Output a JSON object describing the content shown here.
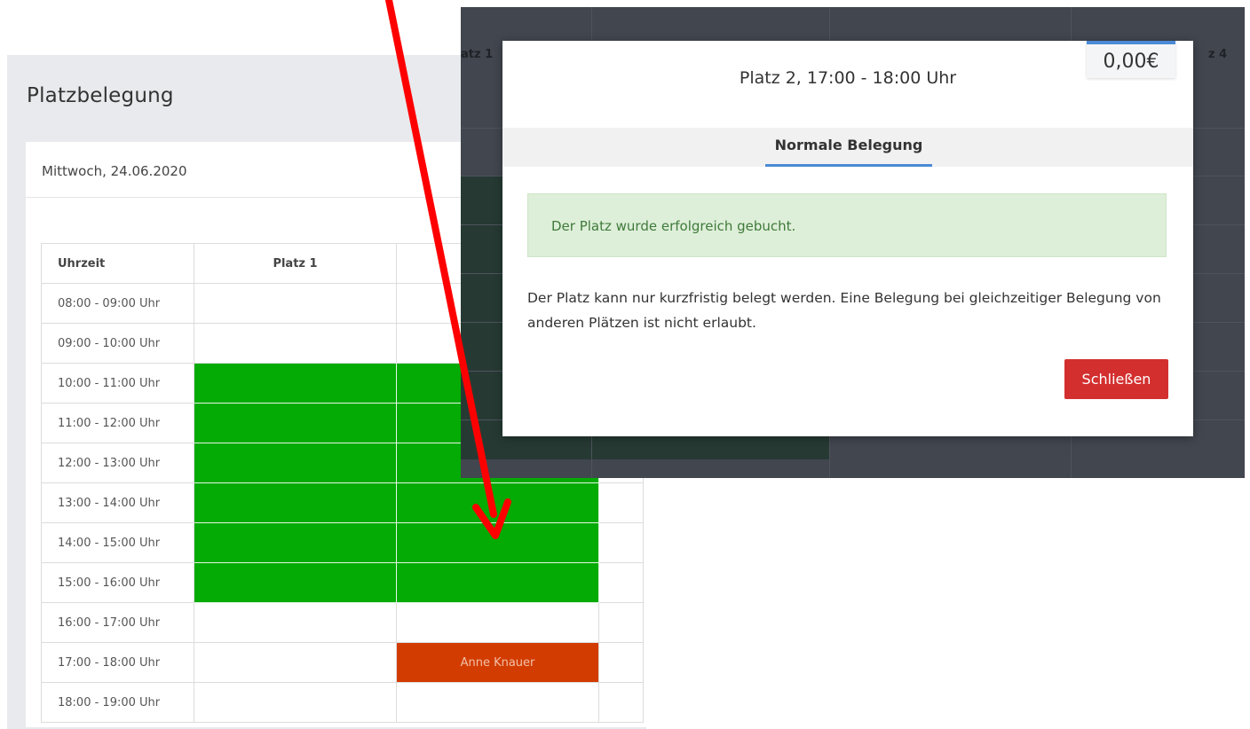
{
  "page": {
    "title": "Platzbelegung",
    "date": "Mittwoch, 24.06.2020"
  },
  "table": {
    "headers": [
      "Uhrzeit",
      "Platz 1",
      ""
    ],
    "rows": [
      {
        "time": "08:00 - 09:00 Uhr"
      },
      {
        "time": "09:00 - 10:00 Uhr"
      },
      {
        "time": "10:00 - 11:00 Uhr"
      },
      {
        "time": "11:00 - 12:00 Uhr"
      },
      {
        "time": "12:00 - 13:00 Uhr"
      },
      {
        "time": "13:00 - 14:00 Uhr"
      },
      {
        "time": "14:00 - 15:00 Uhr"
      },
      {
        "time": "15:00 - 16:00 Uhr"
      },
      {
        "time": "16:00 - 17:00 Uhr"
      },
      {
        "time": "17:00 - 18:00 Uhr",
        "booking": "Anne Knauer"
      },
      {
        "time": "18:00 - 19:00 Uhr"
      }
    ]
  },
  "overlay": {
    "col_partial_left": "atz 1",
    "col_partial_right": "z 4"
  },
  "modal": {
    "title": "Platz 2, 17:00 - 18:00 Uhr",
    "price": "0,00€",
    "tab": "Normale Belegung",
    "alert": "Der Platz wurde erfolgreich gebucht.",
    "text": "Der Platz kann nur kurzfristig belegt werden. Eine Belegung bei gleichzeitiger Belegung von anderen Plätzen ist nicht erlaubt.",
    "close_label": "Schließen"
  },
  "colors": {
    "green_slot": "#04ab04",
    "booked_slot": "#d23c00",
    "close_button": "#d32f2f",
    "accent_blue": "#4a8ad6",
    "arrow": "#ff0000"
  }
}
